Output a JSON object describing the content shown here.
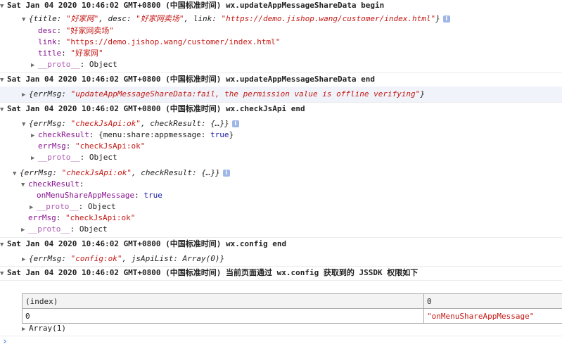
{
  "g1": {
    "header": "Sat Jan 04 2020 10:46:02 GMT+0800 (中国标准时间) wx.updateAppMessageShareData begin",
    "summary_open": "{title: ",
    "title_val": "\"好家网\"",
    "summary_desc_key": ", desc: ",
    "desc_val": "\"好家网卖场\"",
    "summary_link_key": ", link: ",
    "link_val": "\"https://demo.jishop.wang/customer/index.html\"",
    "summary_close": "}",
    "props": [
      {
        "key": "desc",
        "value": "\"好家网卖场\""
      },
      {
        "key": "link",
        "value": "\"https://demo.jishop.wang/customer/index.html\""
      },
      {
        "key": "title",
        "value": "\"好家网\""
      }
    ],
    "proto": "__proto__",
    "proto_val": ": Object"
  },
  "g2": {
    "header": "Sat Jan 04 2020 10:46:02 GMT+0800 (中国标准时间) wx.updateAppMessageShareData end",
    "summary_open": "{errMsg: ",
    "err_val": "\"updateAppMessageShareData:fail, the permission value is offline verifying\"",
    "summary_close": "}"
  },
  "g3": {
    "header": "Sat Jan 04 2020 10:46:02 GMT+0800 (中国标准时间) wx.checkJsApi end",
    "summary_open": "{errMsg: ",
    "err_val": "\"checkJsApi:ok\"",
    "summary_mid": ", checkResult: {…}}",
    "check_key": "checkResult",
    "check_open": ": {menu:share:appmessage: ",
    "check_bool": "true",
    "check_close": "}",
    "errmsg_key": "errMsg",
    "errmsg_val": "\"checkJsApi:ok\"",
    "proto": "__proto__",
    "proto_val": ": Object"
  },
  "g4": {
    "summary_open": "{errMsg: ",
    "err_val": "\"checkJsApi:ok\"",
    "summary_mid": ", checkResult: {…}}",
    "check_key": "checkResult",
    "check_colon": ":",
    "menu_key": "onMenuShareAppMessage",
    "menu_colon": ": ",
    "menu_val": "true",
    "proto1": "__proto__",
    "proto_val": ": Object",
    "errmsg_key": "errMsg",
    "errmsg_val": "\"checkJsApi:ok\"",
    "proto2": "__proto__"
  },
  "g5": {
    "header": "Sat Jan 04 2020 10:46:02 GMT+0800 (中国标准时间) wx.config end",
    "summary_open": "{errMsg: ",
    "err_val": "\"config:ok\"",
    "summary_mid": ", jsApiList: Array(0)}"
  },
  "g6": {
    "header": "Sat Jan 04 2020 10:46:02 GMT+0800 (中国标准时间) 当前页面通过 wx.config 获取到的 JSSDK 权限如下",
    "table": {
      "headers": [
        "(index)",
        "0"
      ],
      "rows": [
        [
          "0",
          "\"onMenuShareAppMessage\""
        ]
      ]
    },
    "array_label": "Array(1)"
  },
  "info_glyph": "i",
  "prompt_glyph": "›"
}
